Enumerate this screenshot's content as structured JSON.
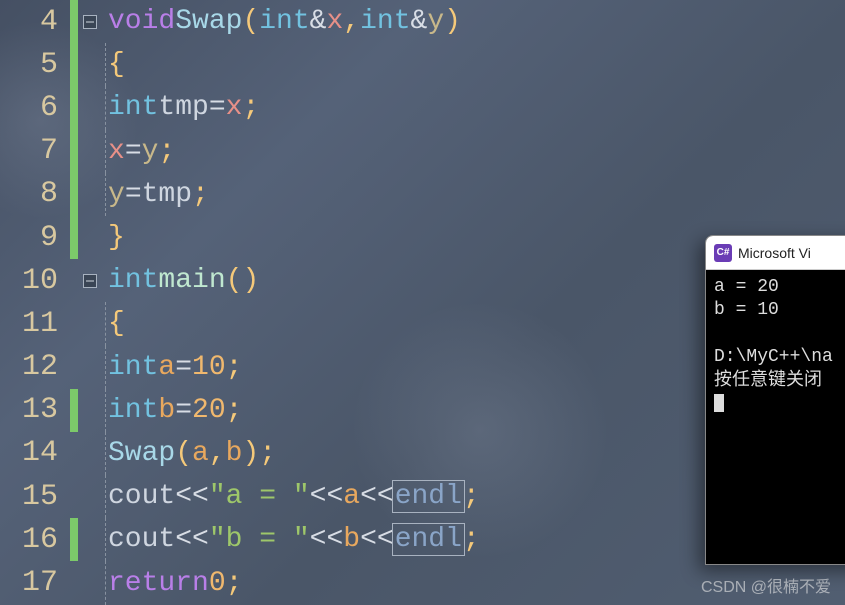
{
  "lines": [
    {
      "num": "4",
      "marker": true,
      "fold": true,
      "struct": false
    },
    {
      "num": "5",
      "marker": true,
      "fold": false,
      "struct": true
    },
    {
      "num": "6",
      "marker": true,
      "fold": false,
      "struct": true
    },
    {
      "num": "7",
      "marker": true,
      "fold": false,
      "struct": true
    },
    {
      "num": "8",
      "marker": true,
      "fold": false,
      "struct": true
    },
    {
      "num": "9",
      "marker": true,
      "fold": false,
      "struct": false
    },
    {
      "num": "10",
      "marker": false,
      "fold": true,
      "struct": false
    },
    {
      "num": "11",
      "marker": false,
      "fold": false,
      "struct": true
    },
    {
      "num": "12",
      "marker": false,
      "fold": false,
      "struct": true
    },
    {
      "num": "13",
      "marker": true,
      "fold": false,
      "struct": true
    },
    {
      "num": "14",
      "marker": false,
      "fold": false,
      "struct": true
    },
    {
      "num": "15",
      "marker": false,
      "fold": false,
      "struct": true
    },
    {
      "num": "16",
      "marker": true,
      "fold": false,
      "struct": true
    },
    {
      "num": "17",
      "marker": false,
      "fold": false,
      "struct": true
    }
  ],
  "tokens": {
    "void": "void",
    "swap": "Swap",
    "int": "int",
    "amp": "&",
    "x": "x",
    "y": "y",
    "tmp": "tmp",
    "eq": "=",
    "semi": ";",
    "comma": ",",
    "lparen": "(",
    "rparen": ")",
    "lbrace": "{",
    "rbrace": "}",
    "main": "main",
    "a": "a",
    "b": "b",
    "n10": "10",
    "n20": "20",
    "n0": "0",
    "cout": "cout",
    "ins": "<<",
    "stra": "\"a = \"",
    "strb": "\"b = \"",
    "endl": "endl",
    "return": "return"
  },
  "terminal": {
    "title": "Microsoft Vi",
    "out1": "a = 20",
    "out2": "b = 10",
    "path": "D:\\MyC++\\na",
    "prompt": "按任意键关闭"
  },
  "watermark": "CSDN @很楠不爱"
}
